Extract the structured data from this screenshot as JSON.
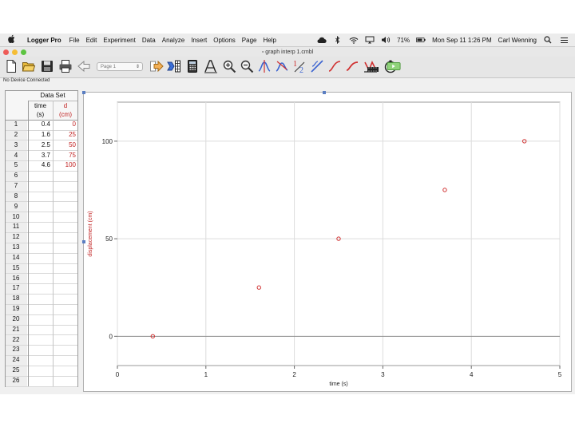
{
  "menubar": {
    "app_name": "Logger Pro",
    "items": [
      "File",
      "Edit",
      "Experiment",
      "Data",
      "Analyze",
      "Insert",
      "Options",
      "Page",
      "Help"
    ],
    "battery": "71%",
    "clock": "Mon Sep 11  1:26 PM",
    "user": "Carl Wenning",
    "icons": [
      "apple-logo",
      "creative-cloud-icon",
      "bluetooth-icon",
      "wifi-icon",
      "airplay-icon",
      "volume-icon",
      "battery-icon",
      "search-icon",
      "notification-icon"
    ]
  },
  "window": {
    "title": "graph interp 1.cmbl",
    "traffic_lights": [
      "#ee5b57",
      "#f5bd34",
      "#5dc441"
    ]
  },
  "toolbar": {
    "page_selector": "Page 1",
    "buttons": [
      "new-file",
      "open-folder",
      "save",
      "print",
      "back",
      "page-selector",
      "next-page",
      "data-table",
      "calculator",
      "text-annotation",
      "zoom-in",
      "zoom-out",
      "examine",
      "tangent",
      "integral",
      "curve-fit-linear",
      "curve-fit",
      "stats",
      "model",
      "video",
      "replay",
      "collect"
    ]
  },
  "status": "No Device Connected",
  "data_set": {
    "name": "Data Set",
    "columns": [
      {
        "name": "time",
        "unit": "(s)",
        "color": "#111111"
      },
      {
        "name": "d",
        "unit": "(cm)",
        "color": "#c02020"
      }
    ],
    "row_numbers": [
      "1",
      "2",
      "3",
      "4",
      "5",
      "6",
      "7",
      "8",
      "9",
      "10",
      "11",
      "12",
      "13",
      "14",
      "15",
      "16",
      "17",
      "18",
      "19",
      "20",
      "21",
      "22",
      "23",
      "24",
      "25",
      "26"
    ],
    "time": [
      "0.4",
      "1.6",
      "2.5",
      "3.7",
      "4.6"
    ],
    "d": [
      "0",
      "25",
      "50",
      "75",
      "100"
    ]
  },
  "chart_data": {
    "type": "scatter",
    "title": "",
    "xlabel": "time (s)",
    "ylabel": "displacement (cm)",
    "xlim": [
      0,
      5
    ],
    "ylim": [
      -15,
      120
    ],
    "x_ticks": [
      "0",
      "1",
      "2",
      "3",
      "4",
      "5"
    ],
    "y_ticks": [
      "0",
      "50",
      "100"
    ],
    "x_tick_values": [
      0,
      1,
      2,
      3,
      4,
      5
    ],
    "y_tick_values": [
      0,
      50,
      100
    ],
    "grid": true,
    "series": [
      {
        "x": [
          0.4,
          1.6,
          2.5,
          3.7,
          4.6
        ],
        "y": [
          0,
          25,
          50,
          75,
          100
        ],
        "color": "#d03030",
        "marker": "open-circle"
      }
    ],
    "ylabel_color": "#c02020"
  }
}
